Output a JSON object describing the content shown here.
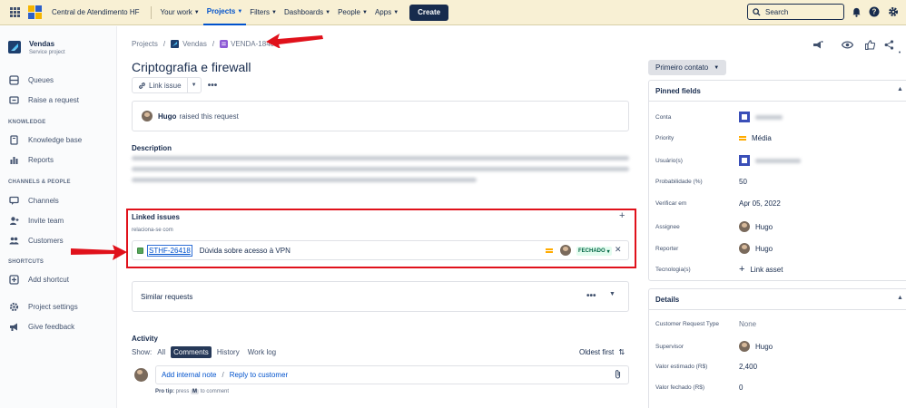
{
  "topbar": {
    "site_title": "Central de Atendimento HF",
    "nav": [
      {
        "label": "Your work",
        "active": false
      },
      {
        "label": "Projects",
        "active": true
      },
      {
        "label": "Filters",
        "active": false
      },
      {
        "label": "Dashboards",
        "active": false
      },
      {
        "label": "People",
        "active": false
      },
      {
        "label": "Apps",
        "active": false
      }
    ],
    "create_label": "Create",
    "search_placeholder": "Search"
  },
  "sidebar": {
    "project_name": "Vendas",
    "project_type": "Service project",
    "items": [
      {
        "label": "Queues",
        "icon": "queues-icon"
      },
      {
        "label": "Raise a request",
        "icon": "raise-request-icon"
      }
    ],
    "knowledge_heading": "KNOWLEDGE",
    "knowledge_items": [
      {
        "label": "Knowledge base",
        "icon": "book-icon"
      },
      {
        "label": "Reports",
        "icon": "reports-icon"
      }
    ],
    "channels_heading": "CHANNELS & PEOPLE",
    "channels_items": [
      {
        "label": "Channels",
        "icon": "channels-icon"
      },
      {
        "label": "Invite team",
        "icon": "invite-icon"
      },
      {
        "label": "Customers",
        "icon": "customers-icon"
      }
    ],
    "shortcuts_heading": "SHORTCUTS",
    "add_shortcut": "Add shortcut",
    "project_settings": "Project settings",
    "give_feedback": "Give feedback"
  },
  "breadcrumb": {
    "projects": "Projects",
    "project": "Vendas",
    "issue_key": "VENDA-1840"
  },
  "issue": {
    "title": "Criptografia e firewall",
    "link_issue_label": "Link issue",
    "raised_by": "Hugo",
    "raised_text": "raised this request",
    "description_label": "Description"
  },
  "linked_issues": {
    "title": "Linked issues",
    "relation": "relaciona-se com",
    "items": [
      {
        "key": "STHF-26418",
        "summary": "Dúvida sobre acesso à VPN",
        "status": "FECHADO"
      }
    ]
  },
  "similar_requests": {
    "label": "Similar requests"
  },
  "activity": {
    "title": "Activity",
    "show_label": "Show:",
    "tabs": [
      {
        "label": "All",
        "active": false
      },
      {
        "label": "Comments",
        "active": true
      },
      {
        "label": "History",
        "active": false
      },
      {
        "label": "Work log",
        "active": false
      }
    ],
    "sort_label": "Oldest first",
    "add_internal_note": "Add internal note",
    "separator": "/",
    "reply_to_customer": "Reply to customer",
    "protip_prefix": "Pro tip:",
    "protip_press": "press",
    "protip_key": "M",
    "protip_suffix": "to comment"
  },
  "right_panel": {
    "status_button": "Primeiro contato",
    "pinned_title": "Pinned fields",
    "pinned_fields": {
      "conta_label": "Conta",
      "priority_label": "Priority",
      "priority_value": "Média",
      "usuarios_label": "Usuário(s)",
      "probabilidade_label": "Probabilidade (%)",
      "probabilidade_value": "50",
      "verificar_label": "Verificar em",
      "verificar_value": "Apr 05, 2022",
      "assignee_label": "Assignee",
      "assignee_value": "Hugo",
      "reporter_label": "Reporter",
      "reporter_value": "Hugo",
      "tecnologia_label": "Tecnologia(s)",
      "tecnologia_value": "Link asset"
    },
    "details_title": "Details",
    "details_fields": {
      "crt_label": "Customer Request Type",
      "crt_value": "None",
      "supervisor_label": "Supervisor",
      "supervisor_value": "Hugo",
      "valor_estimado_label": "Valor estimado (R$)",
      "valor_estimado_value": "2,400",
      "valor_fechado_label": "Valor fechado (R$)",
      "valor_fechado_value": "0"
    }
  },
  "colors": {
    "topbar_bg": "#f8f0d4",
    "accent": "#0052cc",
    "highlight_red": "#e0111b",
    "status_green": "#006644",
    "priority_medium": "#ffab00"
  }
}
